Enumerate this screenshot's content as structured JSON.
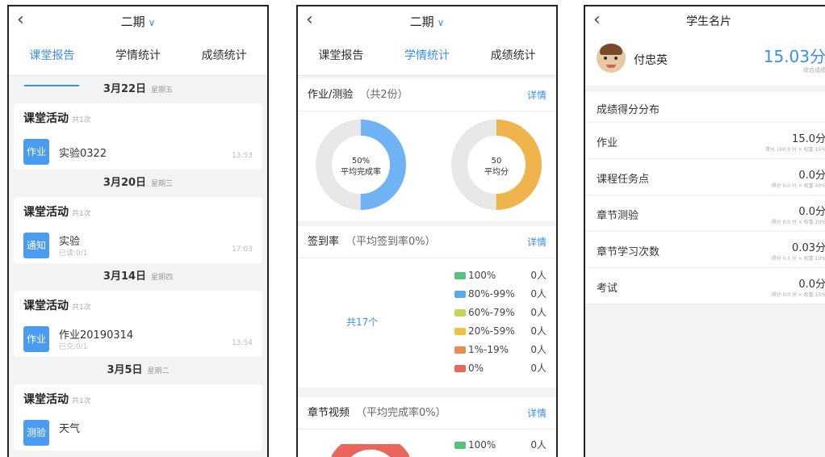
{
  "panel1": {
    "title": "二期",
    "tabs": [
      "课堂报告",
      "学情统计",
      "成绩统计"
    ],
    "groups": [
      {
        "date": "3月22日",
        "weekday": "星期五",
        "activity": "课堂活动",
        "count": "共1次",
        "item": {
          "badge": "作业",
          "badge_color": "#4a9cf2",
          "title": "实验0322",
          "sub": "",
          "time": "13:53"
        }
      },
      {
        "date": "3月20日",
        "weekday": "星期三",
        "activity": "课堂活动",
        "count": "共1次",
        "item": {
          "badge": "通知",
          "badge_color": "#4a9cf2",
          "title": "实验",
          "sub": "已读:0/1",
          "time": "17:03"
        }
      },
      {
        "date": "3月14日",
        "weekday": "星期四",
        "activity": "课堂活动",
        "count": "共1次",
        "item": {
          "badge": "作业",
          "badge_color": "#4a9cf2",
          "title": "作业20190314",
          "sub": "已交:0/1",
          "time": "13:54"
        }
      },
      {
        "date": "3月5日",
        "weekday": "星期二",
        "activity": "课堂活动",
        "count": "共1次",
        "item": {
          "badge": "测验",
          "badge_color": "#4a9cf2",
          "title": "天气",
          "sub": "",
          "time": ""
        }
      }
    ]
  },
  "panel2": {
    "title": "二期",
    "tabs": [
      "课堂报告",
      "学情统计",
      "成绩统计"
    ],
    "homework": {
      "label": "作业/测验",
      "sub": "（共2份）",
      "more": "详情",
      "donut1": {
        "value": "50%",
        "caption": "平均完成率",
        "fraction": 0.5,
        "color": "#6fb3f5"
      },
      "donut2": {
        "value": "50",
        "caption": "平均分",
        "fraction": 0.5,
        "color": "#f0b44c"
      }
    },
    "signin": {
      "label": "签到率",
      "sub": "（平均签到率0%）",
      "more": "详情",
      "total": "共17个",
      "legend": [
        {
          "label": "100%",
          "count": "0人",
          "color": "#58c27d"
        },
        {
          "label": "80%-99%",
          "count": "0人",
          "color": "#5aa8f0"
        },
        {
          "label": "60%-79%",
          "count": "0人",
          "color": "#c8d35a"
        },
        {
          "label": "20%-59%",
          "count": "0人",
          "color": "#f0c040"
        },
        {
          "label": "1%-19%",
          "count": "0人",
          "color": "#ee8a55"
        },
        {
          "label": "0%",
          "count": "0人",
          "color": "#e8675c"
        }
      ]
    },
    "video": {
      "label": "章节视频",
      "sub": "（平均完成率0%）",
      "more": "详情",
      "legend_first": {
        "label": "100%",
        "count": "0人",
        "color": "#58c27d"
      },
      "donut_color": "#e8675c"
    }
  },
  "panel3": {
    "title": "学生名片",
    "student": {
      "name": "付忠英",
      "score": "15.03分",
      "score_caption": "综合成绩"
    },
    "section": "成绩得分分布",
    "rows": [
      {
        "label": "作业",
        "value": "15.0分",
        "detail": "得分 100.0 分 × 权重 15%"
      },
      {
        "label": "课程任务点",
        "value": "0.0分",
        "detail": "得分 0.0 分 × 权重 40%"
      },
      {
        "label": "章节测验",
        "value": "0.0分",
        "detail": "得分 0.0 分 × 权重 20%"
      },
      {
        "label": "章节学习次数",
        "value": "0.03分",
        "detail": "得分 0.3 分 × 权重 10%"
      },
      {
        "label": "考试",
        "value": "0.0分",
        "detail": "得分 0.0 分 × 权重 15%"
      }
    ],
    "accent": "#3a8ef0"
  }
}
